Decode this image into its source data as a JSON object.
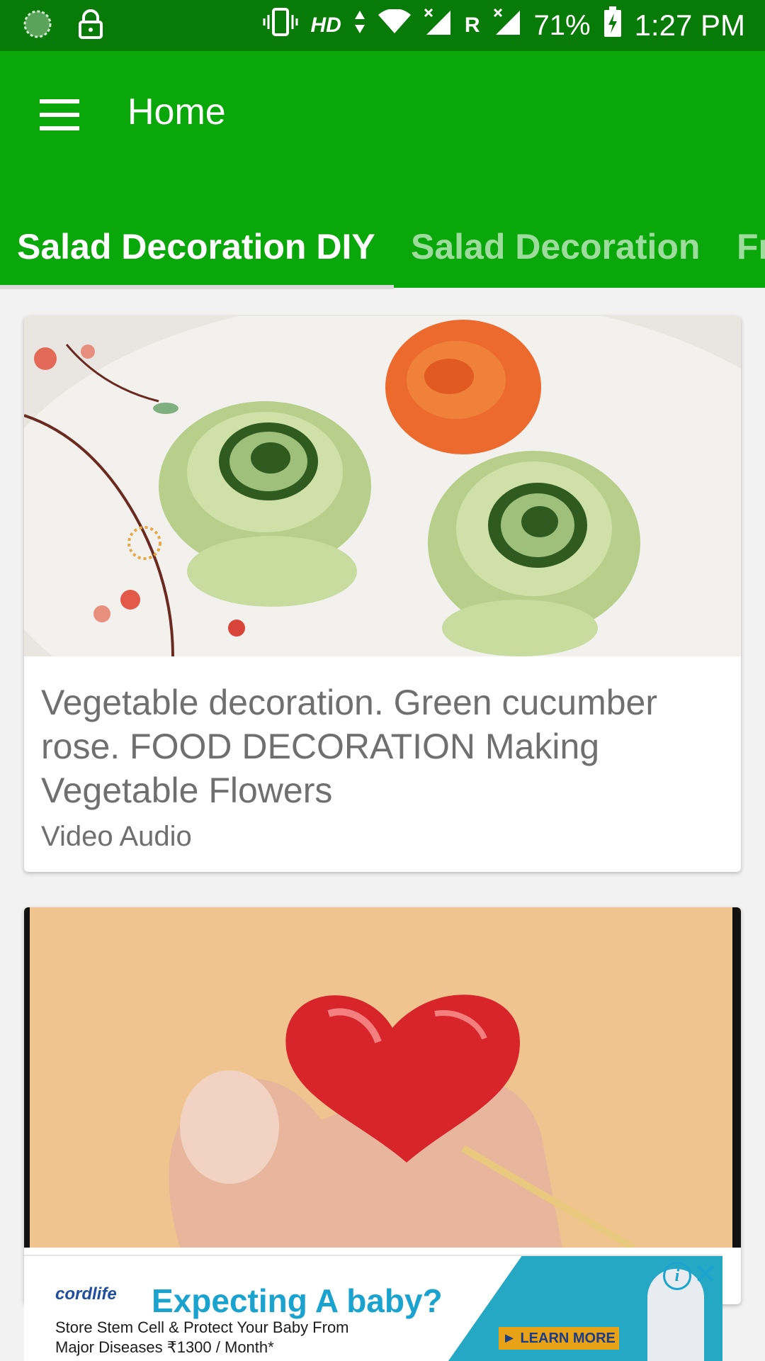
{
  "status_bar": {
    "network": "HD",
    "roaming": "R",
    "battery": "71%",
    "time": "1:27 PM"
  },
  "toolbar": {
    "title": "Home",
    "tabs": [
      {
        "label": "Salad Decoration DIY",
        "active": true
      },
      {
        "label": "Salad Decoration",
        "active": false
      },
      {
        "label": "Fr",
        "active": false
      }
    ]
  },
  "feed": {
    "items": [
      {
        "title": "Vegetable decoration. Green cucumber rose. FOOD DECORATION Making Vegetable Flowers",
        "subtitle": "Video Audio"
      },
      {
        "title": "",
        "subtitle": ""
      }
    ]
  },
  "ad": {
    "brand": "cordlife",
    "headline": "Expecting A baby?",
    "line1": "Store Stem Cell & Protect Your Baby From",
    "line2": "Major Diseases ₹1300 / Month*",
    "cta": "► LEARN MORE",
    "info_symbol": "i",
    "close_symbol": "✕"
  },
  "colors": {
    "status_bar": "#087a08",
    "toolbar": "#0aa70a",
    "ad_accent": "#1aa3cf"
  }
}
